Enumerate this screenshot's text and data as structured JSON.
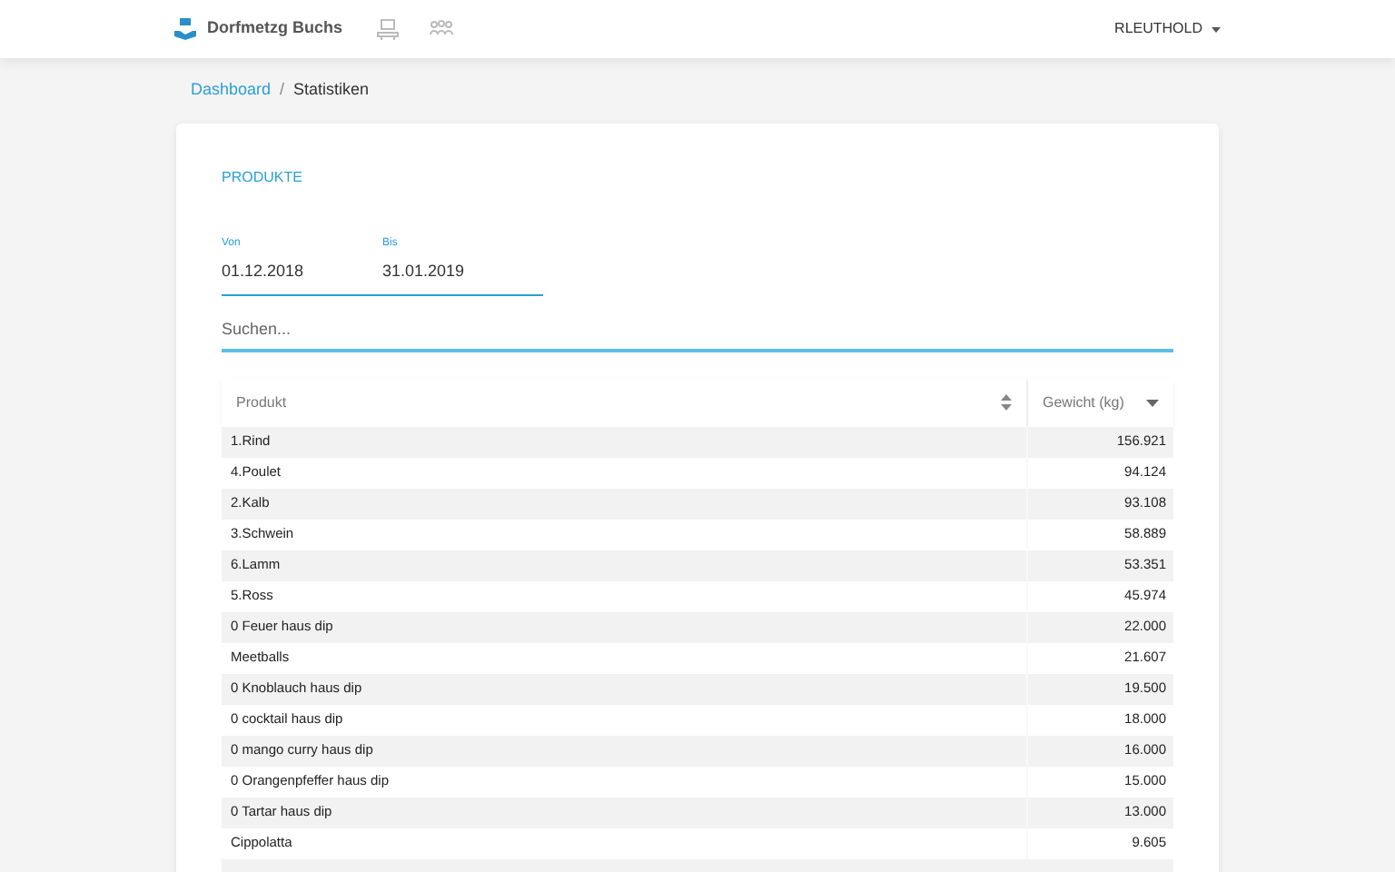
{
  "navbar": {
    "brand": "Dorfmetzg Buchs",
    "user": "RLEUTHOLD"
  },
  "breadcrumb": {
    "separator": "/",
    "items": [
      {
        "label": "Dashboard",
        "kind": "link"
      },
      {
        "label": "Statistiken",
        "kind": "current"
      }
    ]
  },
  "card": {
    "title": "PRODUKTE",
    "date_from": {
      "label": "Von",
      "value": "01.12.2018"
    },
    "date_to": {
      "label": "Bis",
      "value": "31.01.2019"
    },
    "search": {
      "placeholder": "Suchen..."
    },
    "table": {
      "columns": [
        {
          "label": "Produkt",
          "sorted": false
        },
        {
          "label": "Gewicht (kg)",
          "sorted": true
        }
      ],
      "rows": [
        [
          "1.Rind",
          "156.921"
        ],
        [
          "4.Poulet",
          "94.124"
        ],
        [
          "2.Kalb",
          "93.108"
        ],
        [
          "3.Schwein",
          "58.889"
        ],
        [
          "6.Lamm",
          "53.351"
        ],
        [
          "5.Ross",
          "45.974"
        ],
        [
          "0 Feuer haus dip",
          "22.000"
        ],
        [
          "Meetballs",
          "21.607"
        ],
        [
          "0 Knoblauch haus dip",
          "19.500"
        ],
        [
          "0 cocktail haus dip",
          "18.000"
        ],
        [
          "0 mango curry haus dip",
          "16.000"
        ],
        [
          "0 Orangenpfeffer haus dip",
          "15.000"
        ],
        [
          "0 Tartar haus dip",
          "13.000"
        ],
        [
          "Cippolatta",
          "9.605"
        ]
      ]
    }
  }
}
